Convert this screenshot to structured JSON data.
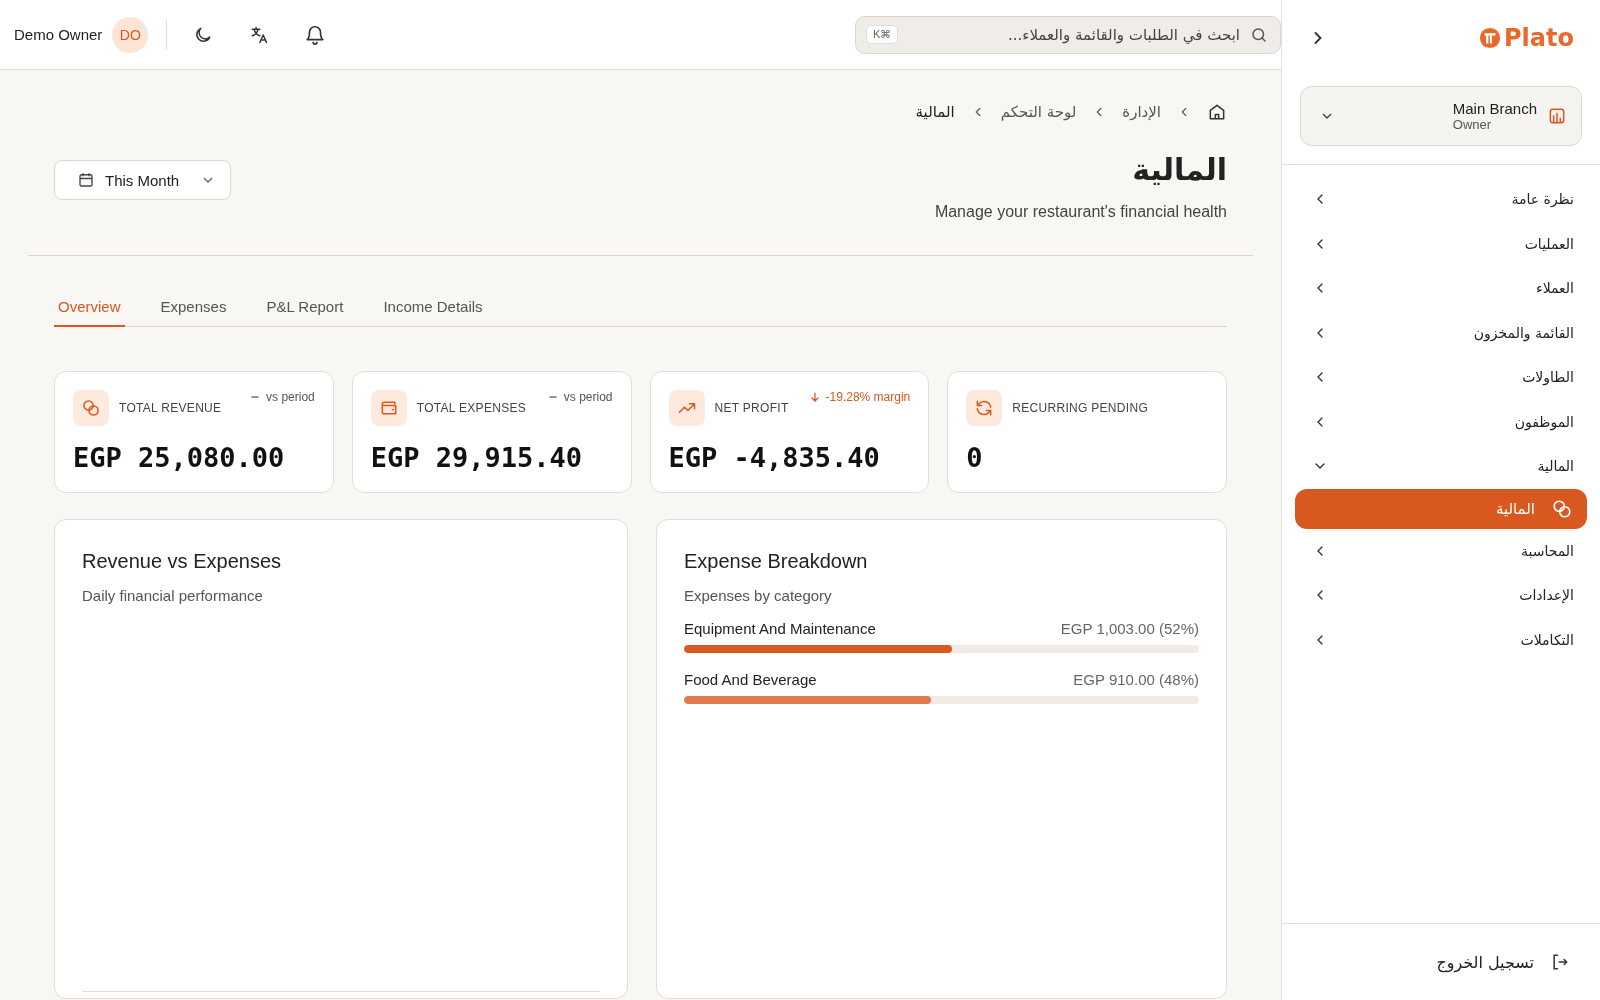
{
  "header": {
    "user_name": "Demo Owner",
    "avatar_initials": "DO",
    "search": {
      "placeholder": "ابحث في الطلبات والقائمة والعملاء...",
      "shortcut": "K⌘"
    }
  },
  "breadcrumb": [
    "الإدارة",
    "لوحة التحكم",
    "المالية"
  ],
  "page": {
    "title": "المالية",
    "subtitle": "Manage your restaurant's financial health",
    "date_filter": "This Month"
  },
  "tabs": [
    {
      "label": "Income Details",
      "selected": false
    },
    {
      "label": "P&L Report",
      "selected": false
    },
    {
      "label": "Expenses",
      "selected": false
    },
    {
      "label": "Overview",
      "selected": true
    }
  ],
  "stats": [
    {
      "kind": "recurring",
      "label": "RECURRING PENDING",
      "value": "0"
    },
    {
      "kind": "profit",
      "label": "NET PROFIT",
      "value": "EGP -4,835.40",
      "trend": {
        "kind": "down",
        "text": "-19.28% margin"
      }
    },
    {
      "kind": "expenses",
      "label": "TOTAL EXPENSES",
      "value": "EGP 29,915.40",
      "trend": {
        "kind": "flat",
        "text": "vs period"
      }
    },
    {
      "kind": "revenue",
      "label": "TOTAL REVENUE",
      "value": "EGP 25,080.00",
      "trend": {
        "kind": "flat",
        "text": "vs period"
      }
    }
  ],
  "revenue_chart": {
    "title": "Revenue vs Expenses",
    "subtitle": "Daily financial performance"
  },
  "expense_breakdown": {
    "title": "Expense Breakdown",
    "subtitle": "Expenses by category",
    "categories": [
      {
        "name": "Equipment And Maintenance",
        "amount": "EGP 1,003.00 (52%)",
        "level": 0.52,
        "color": "#d9581f"
      },
      {
        "name": "Food And Beverage",
        "amount": "EGP 910.00 (48%)",
        "level": 0.48,
        "color": "#e07a4e"
      }
    ]
  },
  "sidebar": {
    "logo": "Plato",
    "branch": {
      "name": "Main Branch",
      "role": "Owner"
    },
    "items": [
      {
        "label": "نظرة عامة",
        "expanded": false
      },
      {
        "label": "العمليات",
        "expanded": false
      },
      {
        "label": "العملاء",
        "expanded": false
      },
      {
        "label": "القائمة والمخزون",
        "expanded": false
      },
      {
        "label": "الطاولات",
        "expanded": false
      },
      {
        "label": "الموظفون",
        "expanded": false
      },
      {
        "label": "المالية",
        "expanded": true,
        "children": [
          {
            "label": "المالية",
            "selected": true
          }
        ]
      },
      {
        "label": "المحاسبة",
        "expanded": false
      },
      {
        "label": "الإعدادات",
        "expanded": false
      },
      {
        "label": "التكاملات",
        "expanded": false
      }
    ],
    "logout": "تسجيل الخروج"
  }
}
